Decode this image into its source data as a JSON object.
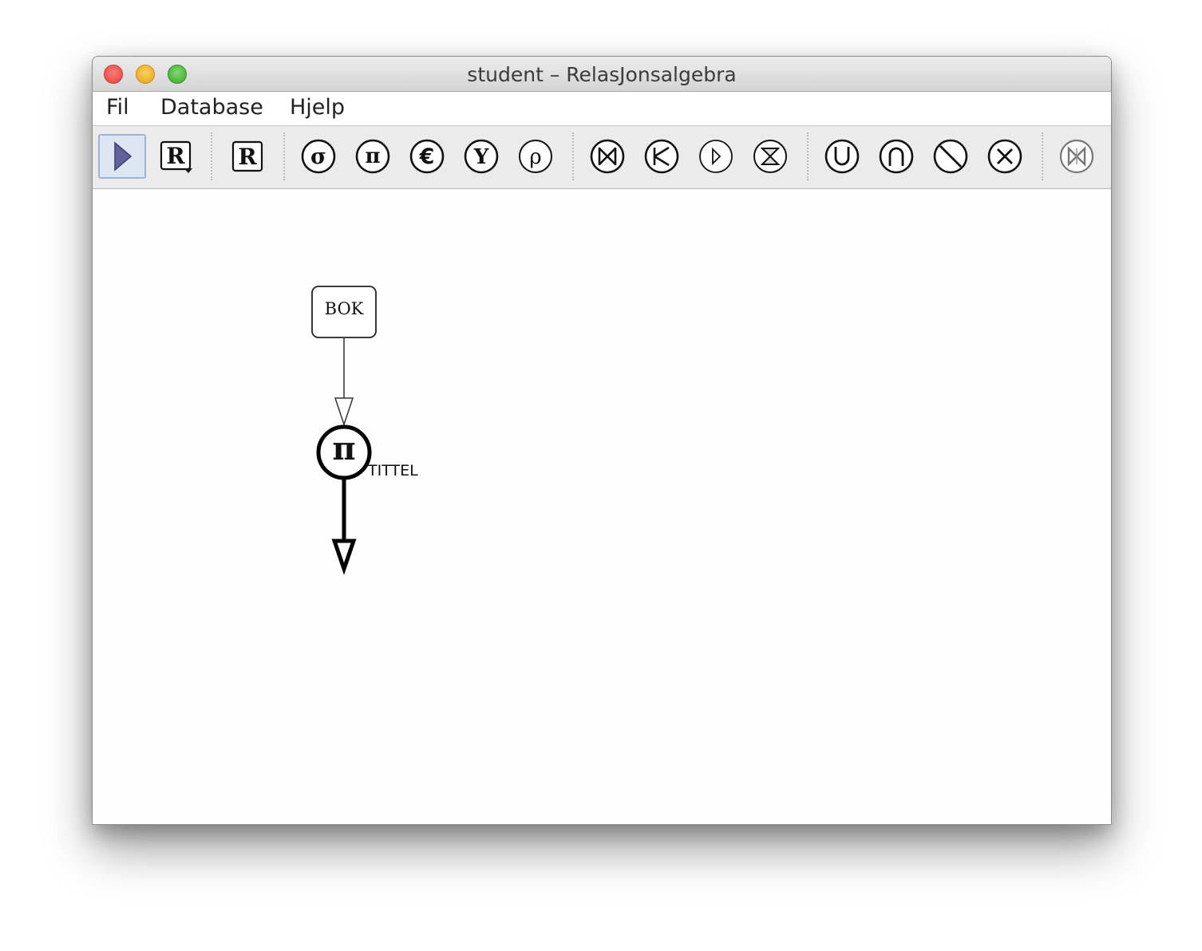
{
  "window": {
    "title": "student – RelasJonsalgebra"
  },
  "menu": {
    "items": [
      {
        "label": "Fil"
      },
      {
        "label": "Database"
      },
      {
        "label": "Hjelp"
      }
    ]
  },
  "toolbar": {
    "tools": [
      {
        "name": "select-tool",
        "icon": "pointer-arrow-icon",
        "glyph": "",
        "selected": true
      },
      {
        "name": "relation-menu-tool",
        "icon": "relation-dropdown-icon",
        "glyph": "R"
      },
      {
        "name": "relation-tool",
        "icon": "relation-icon",
        "glyph": "R"
      },
      {
        "name": "selection-tool",
        "icon": "sigma-icon",
        "glyph": "σ"
      },
      {
        "name": "projection-tool",
        "icon": "pi-icon",
        "glyph": "π"
      },
      {
        "name": "extended-projection-tool",
        "icon": "epsilon-icon",
        "glyph": "€"
      },
      {
        "name": "grouping-tool",
        "icon": "gamma-icon",
        "glyph": "Y"
      },
      {
        "name": "rename-tool",
        "icon": "rho-icon",
        "glyph": "ρ"
      },
      {
        "name": "join-tool",
        "icon": "join-icon",
        "glyph": "⋈"
      },
      {
        "name": "left-semijoin-tool",
        "icon": "semijoin-icon",
        "glyph": "⋉"
      },
      {
        "name": "triangle-tool",
        "icon": "triangle-icon",
        "glyph": "▷"
      },
      {
        "name": "division-tool",
        "icon": "hourglass-icon",
        "glyph": "⧗"
      },
      {
        "name": "union-tool",
        "icon": "union-icon",
        "glyph": "∪"
      },
      {
        "name": "intersection-tool",
        "icon": "intersection-icon",
        "glyph": "∩"
      },
      {
        "name": "difference-tool",
        "icon": "difference-icon",
        "glyph": "\\"
      },
      {
        "name": "cartesian-product-tool",
        "icon": "times-icon",
        "glyph": "×"
      },
      {
        "name": "outer-join-tool",
        "icon": "outer-join-icon",
        "glyph": "⋈",
        "disabled": true
      }
    ]
  },
  "diagram": {
    "relation_node": {
      "label": "BOK"
    },
    "projection_node": {
      "symbol": "π",
      "attribute_label": "TITTEL"
    }
  },
  "colors": {
    "accent_selected": "#9fb3d8",
    "arrow_play": "#5e5e9e"
  }
}
